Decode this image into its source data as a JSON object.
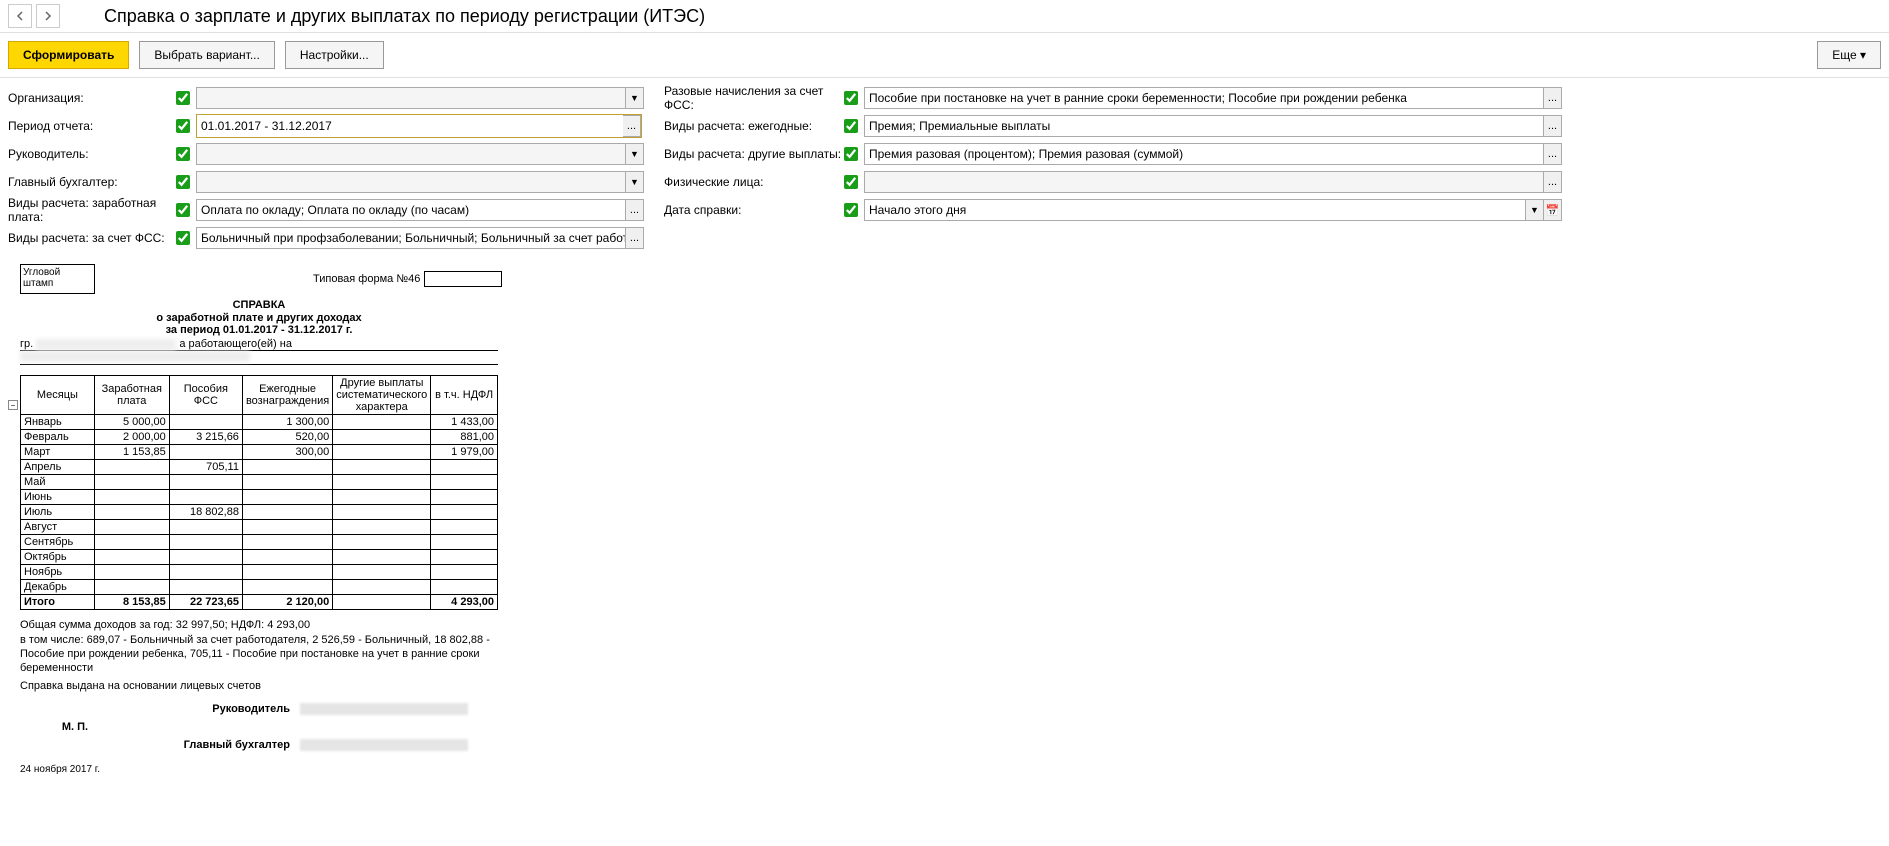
{
  "title": "Справка о зарплате и других выплатах по периоду регистрации (ИТЭС)",
  "toolbar": {
    "generate": "Сформировать",
    "variant": "Выбрать вариант...",
    "settings": "Настройки...",
    "more": "Еще"
  },
  "form": {
    "left": {
      "org_label": "Организация:",
      "org_value": "",
      "period_label": "Период отчета:",
      "period_value": "01.01.2017 - 31.12.2017",
      "head_label": "Руководитель:",
      "head_value": "",
      "acc_label": "Главный бухгалтер:",
      "acc_value": "",
      "salary_types_label": "Виды расчета: заработная плата:",
      "salary_types_value": "Оплата по окладу; Оплата по окладу (по часам)",
      "fss_types_label": "Виды расчета: за счет ФСС:",
      "fss_types_value": "Больничный при профзаболевании; Больничный; Больничный за счет работодателя"
    },
    "right": {
      "fss_once_label": "Разовые начисления за счет ФСС:",
      "fss_once_value": "Пособие при постановке на учет в ранние сроки беременности; Пособие при рождении ребенка",
      "annual_label": "Виды расчета: ежегодные:",
      "annual_value": "Премия; Премиальные выплаты",
      "other_label": "Виды расчета: другие выплаты:",
      "other_value": "Премия разовая (процентом); Премия разовая (суммой)",
      "persons_label": "Физические лица:",
      "persons_value": "",
      "date_label": "Дата справки:",
      "date_value": "Начало этого дня"
    }
  },
  "report": {
    "stamp": "Угловой штамп",
    "form_num_label": "Типовая форма №46",
    "title1": "СПРАВКА",
    "title2": "о заработной плате и других доходах",
    "title3": "за период 01.01.2017 - 31.12.2017 г.",
    "gr_prefix": "гр.",
    "gr_mid": "а работающего(ей) на",
    "headers": {
      "month": "Месяцы",
      "salary": "Заработная плата",
      "fss": "Пособия ФСС",
      "annual": "Ежегодные вознаграждения",
      "other": "Другие выплаты систематического характера",
      "ndfl": "в т.ч. НДФЛ"
    },
    "rows": [
      {
        "m": "Январь",
        "s": "5 000,00",
        "f": "",
        "a": "1 300,00",
        "o": "",
        "n": "1 433,00"
      },
      {
        "m": "Февраль",
        "s": "2 000,00",
        "f": "3 215,66",
        "a": "520,00",
        "o": "",
        "n": "881,00"
      },
      {
        "m": "Март",
        "s": "1 153,85",
        "f": "",
        "a": "300,00",
        "o": "",
        "n": "1 979,00"
      },
      {
        "m": "Апрель",
        "s": "",
        "f": "705,11",
        "a": "",
        "o": "",
        "n": ""
      },
      {
        "m": "Май",
        "s": "",
        "f": "",
        "a": "",
        "o": "",
        "n": ""
      },
      {
        "m": "Июнь",
        "s": "",
        "f": "",
        "a": "",
        "o": "",
        "n": ""
      },
      {
        "m": "Июль",
        "s": "",
        "f": "18 802,88",
        "a": "",
        "o": "",
        "n": ""
      },
      {
        "m": "Август",
        "s": "",
        "f": "",
        "a": "",
        "o": "",
        "n": ""
      },
      {
        "m": "Сентябрь",
        "s": "",
        "f": "",
        "a": "",
        "o": "",
        "n": ""
      },
      {
        "m": "Октябрь",
        "s": "",
        "f": "",
        "a": "",
        "o": "",
        "n": ""
      },
      {
        "m": "Ноябрь",
        "s": "",
        "f": "",
        "a": "",
        "o": "",
        "n": ""
      },
      {
        "m": "Декабрь",
        "s": "",
        "f": "",
        "a": "",
        "o": "",
        "n": ""
      }
    ],
    "total": {
      "m": "Итого",
      "s": "8 153,85",
      "f": "22 723,65",
      "a": "2 120,00",
      "o": "",
      "n": "4 293,00"
    },
    "summary1": "Общая сумма доходов за год: 32 997,50; НДФЛ: 4 293,00",
    "summary2": "в том числе: 689,07 - Больничный за счет работодателя, 2 526,59 - Больничный, 18 802,88 - Пособие при рождении ребенка, 705,11 - Пособие при постановке на учет в ранние сроки беременности",
    "summary3": "Справка выдана на основании лицевых счетов",
    "sig_head": "Руководитель",
    "sig_mp": "М. П.",
    "sig_acc": "Главный бухгалтер",
    "date": "24 ноября 2017 г."
  }
}
